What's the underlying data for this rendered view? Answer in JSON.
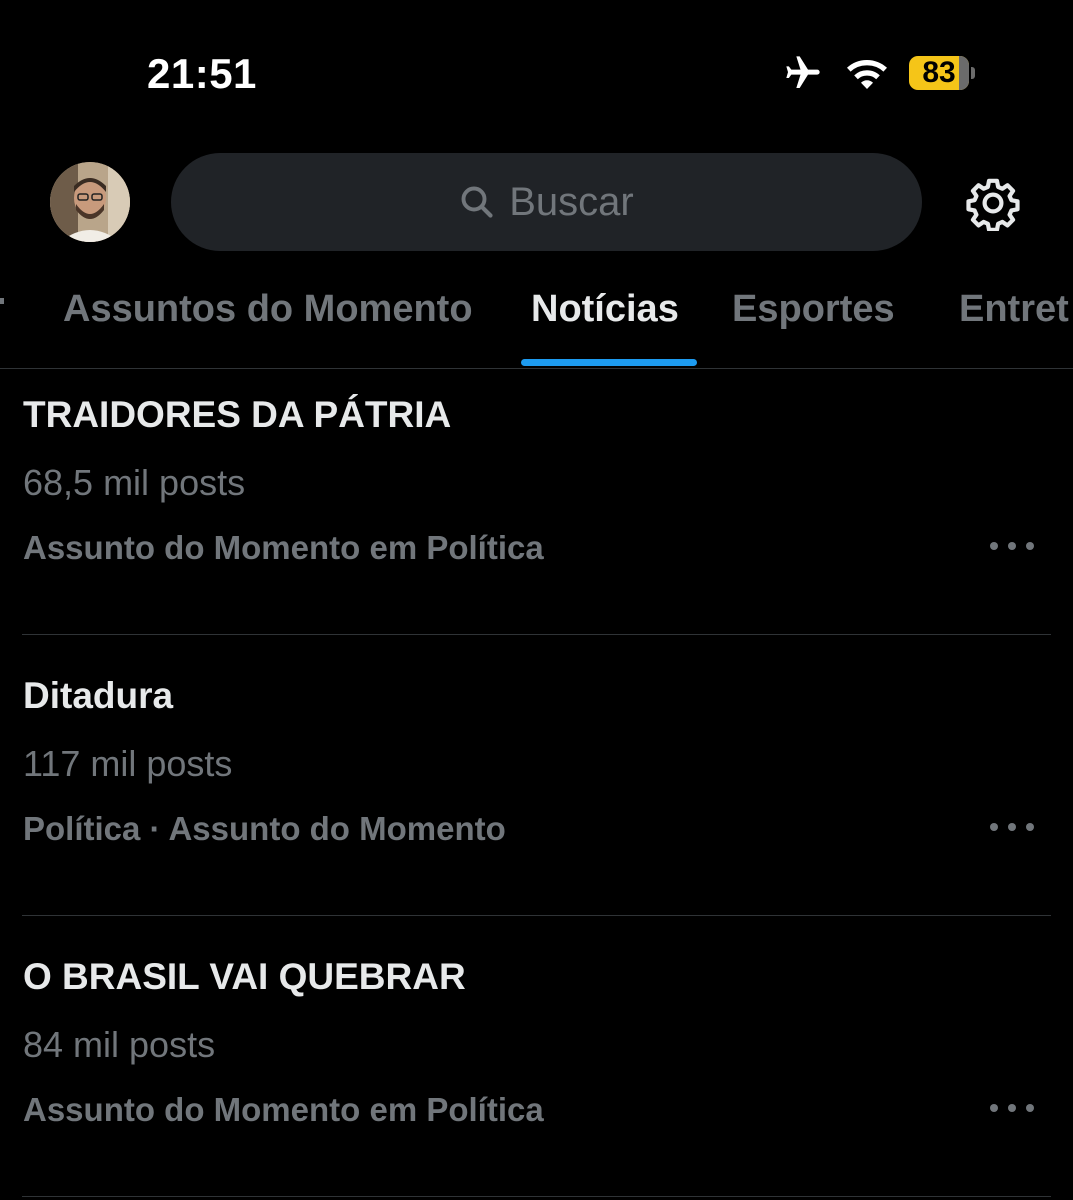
{
  "status_bar": {
    "time": "21:51",
    "icons": [
      "airplane-icon",
      "wifi-icon",
      "battery-icon"
    ],
    "battery_level": "83",
    "battery_color": "#f5c518"
  },
  "header": {
    "search_placeholder": "Buscar",
    "search_icon": "search-icon",
    "settings_icon": "gear-icon"
  },
  "tabs": [
    {
      "label": "Assuntos do Momento",
      "active": false
    },
    {
      "label": "Notícias",
      "active": true
    },
    {
      "label": "Esportes",
      "active": false
    },
    {
      "label": "Entret",
      "active": false
    }
  ],
  "accent_color": "#1d9bf0",
  "trends": [
    {
      "name": "TRAIDORES DA PÁTRIA",
      "count": "68,5 mil posts",
      "context": "Assunto do Momento em Política"
    },
    {
      "name": "Ditadura",
      "count": "117 mil posts",
      "context": "Política · Assunto do Momento"
    },
    {
      "name": "O BRASIL VAI QUEBRAR",
      "count": "84 mil posts",
      "context": "Assunto do Momento em Política"
    }
  ]
}
